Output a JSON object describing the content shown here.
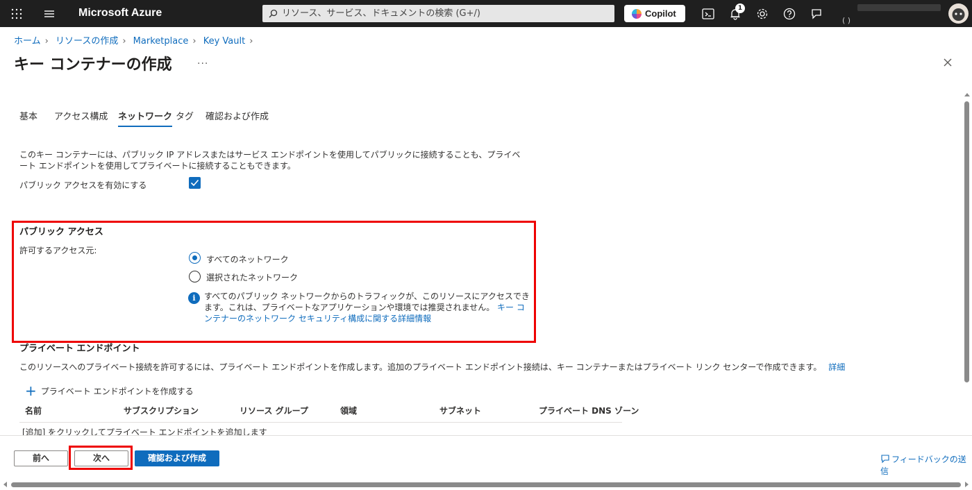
{
  "topbar": {
    "brand": "Microsoft Azure",
    "search_placeholder": "リソース、サービス、ドキュメントの検索 (G+/)",
    "copilot_label": "Copilot",
    "notification_count": "1",
    "user_line2": "(             )"
  },
  "breadcrumb": {
    "items": [
      "ホーム",
      "リソースの作成",
      "Marketplace",
      "Key Vault"
    ]
  },
  "page": {
    "title": "キー コンテナーの作成",
    "more": "..."
  },
  "tabs": [
    {
      "label": "基本"
    },
    {
      "label": "アクセス構成"
    },
    {
      "label": "ネットワーク",
      "active": true
    },
    {
      "label": "タグ"
    },
    {
      "label": "確認および作成"
    }
  ],
  "network": {
    "description": "このキー コンテナーには、パブリック IP アドレスまたはサービス エンドポイントを使用してパブリックに接続することも、プライベート エンドポイントを使用してプライベートに接続することもできます。",
    "enable_public_label": "パブリック アクセスを有効にする",
    "enable_public_checked": true
  },
  "public_access": {
    "title": "パブリック アクセス",
    "allow_label": "許可するアクセス元:",
    "options": [
      {
        "label": "すべてのネットワーク",
        "selected": true
      },
      {
        "label": "選択されたネットワーク",
        "selected": false
      }
    ],
    "info_text": "すべてのパブリック ネットワークからのトラフィックが、このリソースにアクセスできます。これは、プライベートなアプリケーションや環境では推奨されません。",
    "info_link": "キー コンテナーのネットワーク セキュリティ構成に関する詳細情報"
  },
  "private_endpoint": {
    "title": "プライベート エンドポイント",
    "description": "このリソースへのプライベート接続を許可するには、プライベート エンドポイントを作成します。追加のプライベート エンドポイント接続は、キー コンテナーまたはプライベート リンク センターで作成できます。",
    "details_link": "詳細",
    "add_label": "プライベート エンドポイントを作成する",
    "columns": [
      "名前",
      "サブスクリプション",
      "リソース グループ",
      "領域",
      "サブネット",
      "プライベート DNS ゾーン"
    ],
    "empty_text": "[追加] をクリックしてプライベート エンドポイントを追加します"
  },
  "footer": {
    "prev": "前へ",
    "next": "次へ",
    "review": "確認および作成",
    "feedback": "フィードバックの送信"
  },
  "colors": {
    "accent": "#0f6cbd",
    "highlight": "#ee0000",
    "topbar": "#1f1f1f"
  }
}
